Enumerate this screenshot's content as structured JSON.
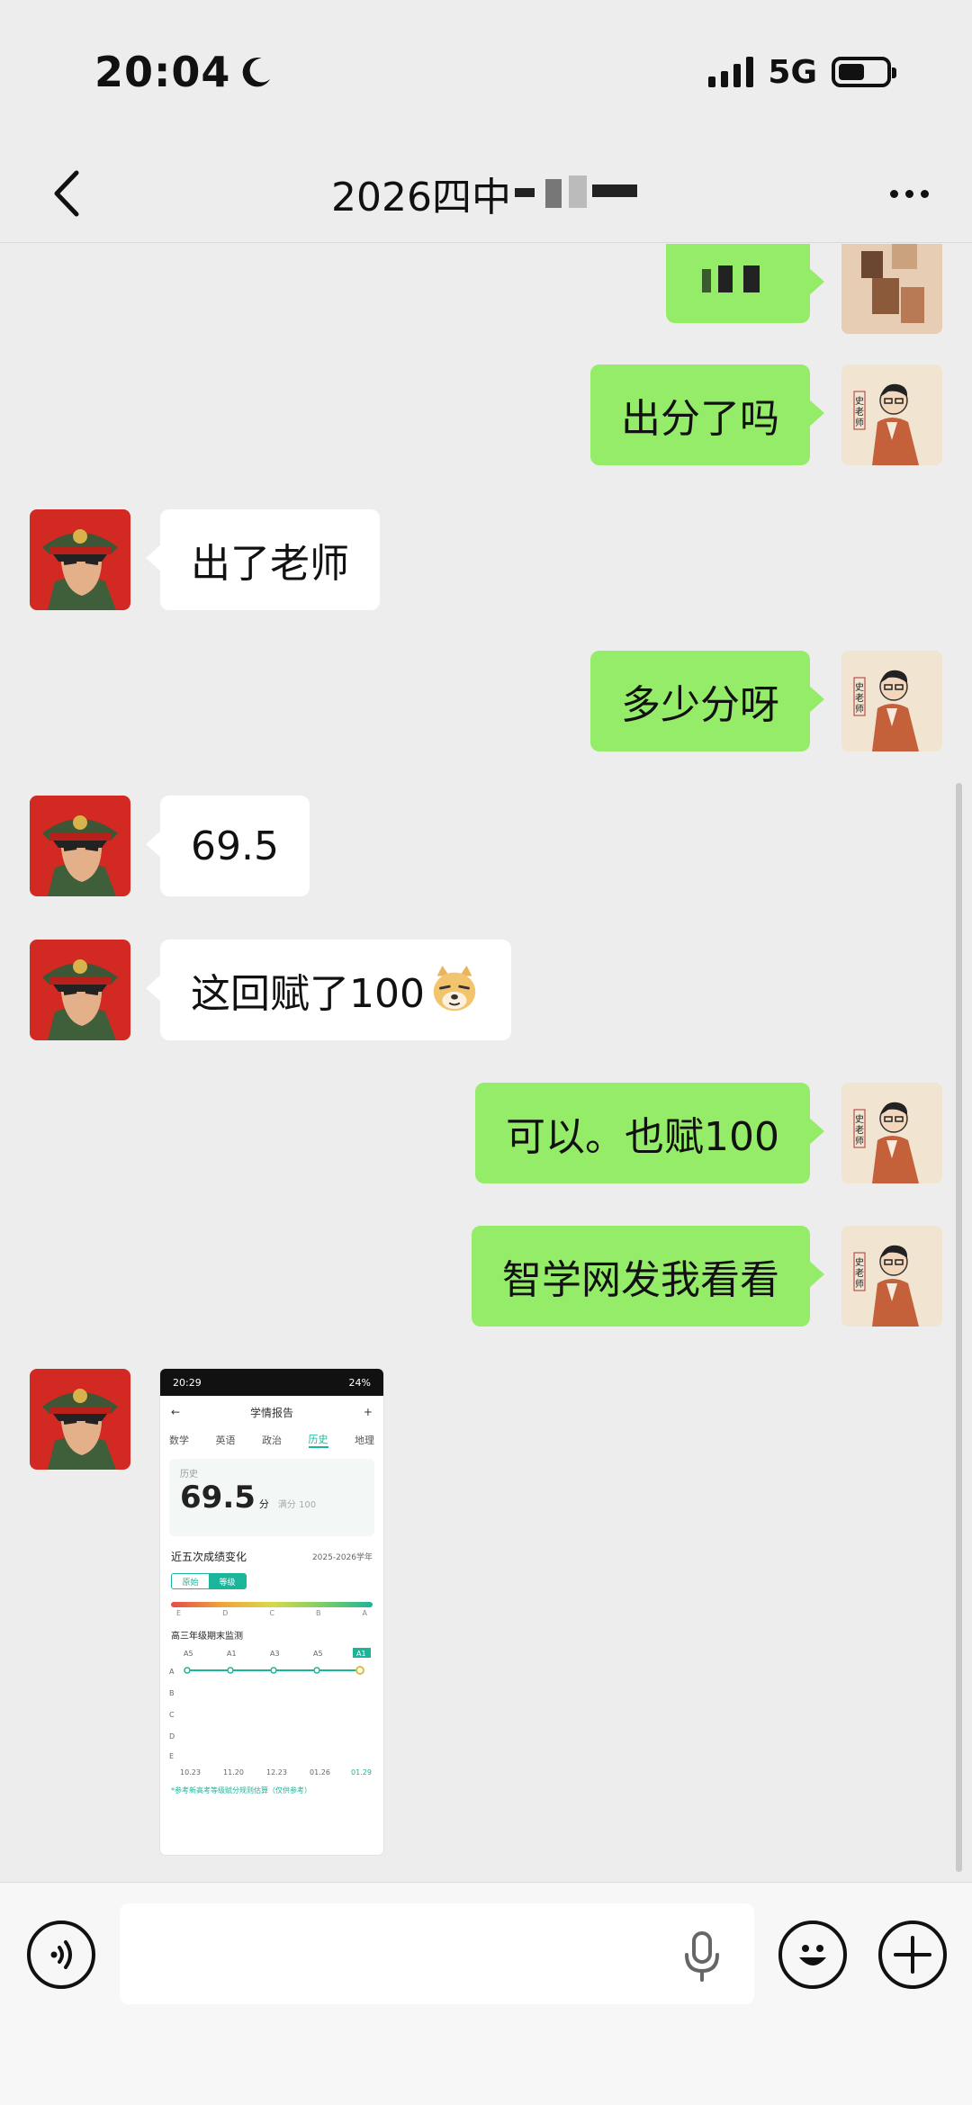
{
  "status_bar": {
    "time": "20:04",
    "network": "5G"
  },
  "header": {
    "title": "2026四中"
  },
  "messages": [
    {
      "side": "right",
      "text": "",
      "avatar": "blurred-avatar"
    },
    {
      "side": "right",
      "text": "出分了吗",
      "avatar": "teacher-avatar"
    },
    {
      "side": "left",
      "text": "出了老师",
      "avatar": "officer-avatar"
    },
    {
      "side": "right",
      "text": "多少分呀",
      "avatar": "teacher-avatar"
    },
    {
      "side": "left",
      "text": "69.5",
      "avatar": "officer-avatar"
    },
    {
      "side": "left",
      "text": "这回赋了100",
      "avatar": "officer-avatar",
      "emoji": "doge-emoji"
    },
    {
      "side": "right",
      "text": "可以。也赋100",
      "avatar": "teacher-avatar"
    },
    {
      "side": "right",
      "text": "智学网发我看看",
      "avatar": "teacher-avatar"
    }
  ],
  "shared_image": {
    "status_time": "20:29",
    "status_battery": "24%",
    "title": "学情报告",
    "plus": "+",
    "tabs": [
      "数学",
      "英语",
      "政治",
      "历史",
      "地理"
    ],
    "active_tab": "历史",
    "subject": "历史",
    "score": "69.5",
    "score_unit": "分",
    "full_score": "满分 100",
    "trend_title": "近五次成绩变化",
    "year_selector": "2025-2026学年",
    "toggle": [
      "原始",
      "等级"
    ],
    "scale": [
      "E",
      "D",
      "C",
      "B",
      "A"
    ],
    "exam_name": "高三年级期末监测",
    "grades": [
      "A5",
      "A1",
      "A3",
      "A5",
      "A1"
    ],
    "grade_axis": [
      "A",
      "B",
      "C",
      "D",
      "E"
    ],
    "dates": [
      "10.23",
      "11.20",
      "12.23",
      "01.26",
      "01.29"
    ],
    "footnote": "*参考新高考等级赋分规则估算（仅供参考）"
  },
  "input_bar": {
    "placeholder": ""
  }
}
